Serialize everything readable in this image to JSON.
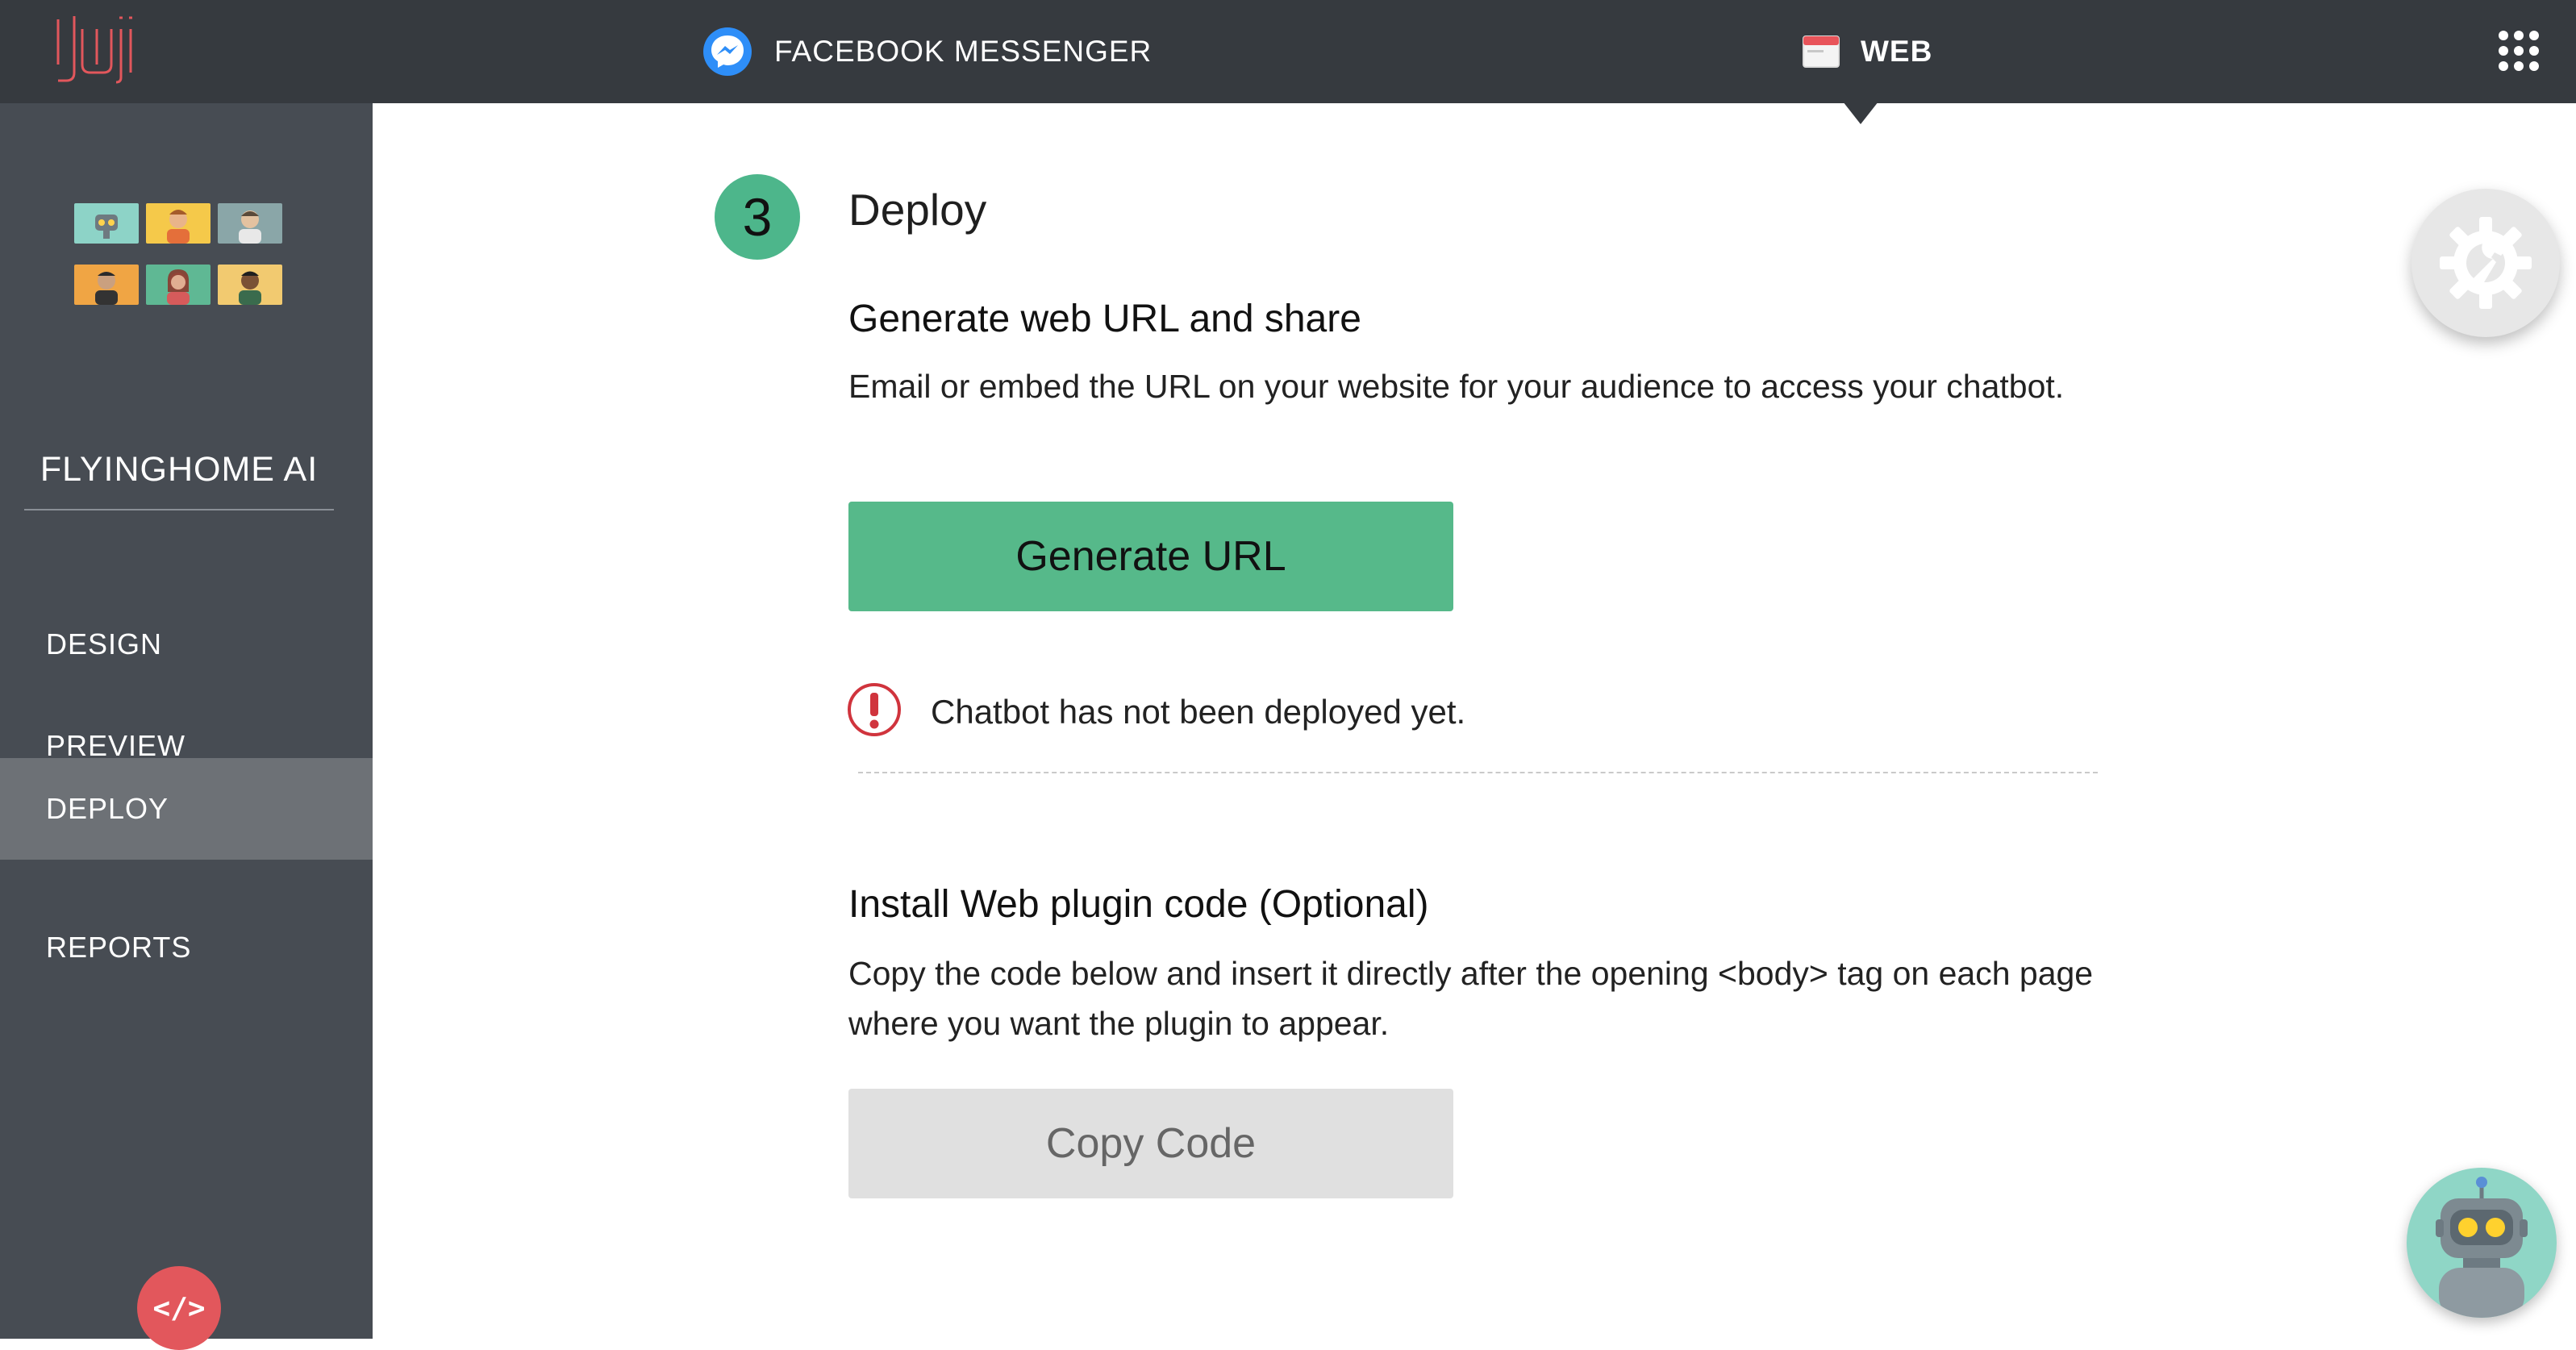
{
  "topbar": {
    "logo_text": "Juji",
    "tabs": [
      {
        "label": "FACEBOOK MESSENGER",
        "icon": "messenger-icon",
        "active": false
      },
      {
        "label": "WEB",
        "icon": "browser-window-icon",
        "active": true
      }
    ],
    "apps_icon": "grid-apps-icon"
  },
  "sidebar": {
    "project_name": "FLYINGHOME AI",
    "nav": [
      {
        "label": "DESIGN",
        "active": false
      },
      {
        "label": "PREVIEW",
        "active": false
      },
      {
        "label": "DEPLOY",
        "active": true
      },
      {
        "label": "REPORTS",
        "active": false
      }
    ],
    "code_button": {
      "label": "</>"
    }
  },
  "main": {
    "step": {
      "number": "3",
      "title": "Deploy"
    },
    "web_url": {
      "title": "Generate web URL and share",
      "description": "Email or embed the URL on your website for your audience to access your chatbot.",
      "button_label": "Generate URL",
      "status_text": "Chatbot has not been deployed yet."
    },
    "plugin": {
      "title": "Install Web plugin code (Optional)",
      "description": "Copy the code below and insert it directly after the opening <body> tag on each page where you want the plugin to appear.",
      "button_label": "Copy Code"
    }
  },
  "widgets": {
    "settings_icon": "gear-wrench-icon",
    "bot_icon": "robot-avatar-icon"
  },
  "colors": {
    "topbar_bg": "#363a3f",
    "sidebar_bg": "#474c53",
    "sidebar_active": "#6d7176",
    "accent_green": "#56b98a",
    "brand_red": "#e2575c",
    "warning_red": "#d0343d"
  }
}
